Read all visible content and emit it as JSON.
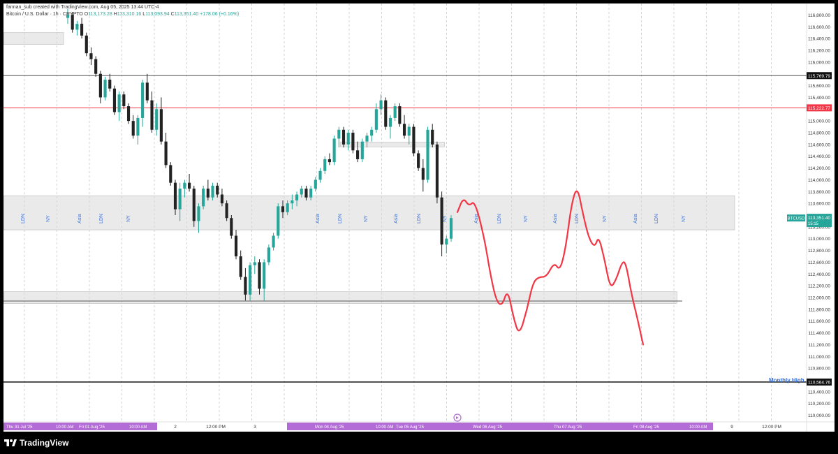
{
  "header": {
    "author_line": "fannan_sub created with TradingView.com, Aug 05, 2025 13:44 UTC-4",
    "symbol_line": "Bitcoin / U.S. Dollar · 1h · CRYPTO",
    "ohlc": {
      "o_label": "O",
      "o": "113,173.28",
      "h_label": "H",
      "h": "113,310.16",
      "l_label": "L",
      "l": "113,093.94",
      "c_label": "C",
      "c": "113,351.40",
      "change": "+178.06 (+0.16%)"
    }
  },
  "colors": {
    "up": "#26a69a",
    "down": "#222222",
    "red": "#f23645",
    "zone": "#d9d9d9",
    "session": "#3a6fd8",
    "purple": "#b36bd6"
  },
  "price_axis": {
    "ticks": [
      "116,800.00",
      "116,600.00",
      "116,400.00",
      "116,200.00",
      "116,000.00",
      "115,800.00",
      "115,600.00",
      "115,400.00",
      "115,200.00",
      "115,000.00",
      "114,800.00",
      "114,600.00",
      "114,400.00",
      "114,200.00",
      "114,000.00",
      "113,800.00",
      "113,600.00",
      "113,400.00",
      "113,200.00",
      "113,000.00",
      "112,800.00",
      "112,600.00",
      "112,400.00",
      "112,200.00",
      "112,000.00",
      "111,800.00",
      "111,600.00",
      "111,400.00",
      "111,200.00",
      "111,000.00",
      "110,800.00",
      "110,600.00",
      "110,400.00",
      "110,200.00",
      "110,000.00"
    ],
    "labels": [
      {
        "text": "115,769.79",
        "kind": "black"
      },
      {
        "text": "115,222.77",
        "kind": "red"
      },
      {
        "text": "113,351.40",
        "kind": "green",
        "ticker": "BTCUSD",
        "sub": "15:15"
      },
      {
        "text": "110,564.76",
        "kind": "black"
      }
    ]
  },
  "annotations": {
    "monthly_high": "Monthly High"
  },
  "sessions": [
    "LDN",
    "NY",
    "Asia",
    "LDN",
    "NY",
    "Asia",
    "LDN",
    "NY",
    "Asia",
    "LDN",
    "NY",
    "Asia",
    "LDN",
    "NY",
    "Asia",
    "LDN",
    "NY",
    "Asia",
    "LDN",
    "NY"
  ],
  "time_axis": {
    "labels": [
      "2",
      "12:00 PM",
      "3",
      "9",
      "12:00 PM"
    ],
    "highlight_text": [
      "Thu 31 Jul '25",
      "10:00 AM",
      "Fri 01 Aug '25",
      "10:00 AM",
      "Mon 04 Aug '25",
      "10:00 AM",
      "Tue 05 Aug '25",
      "Wed 06 Aug '25",
      "Thu 07 Aug '25",
      "Fri 08 Aug '25",
      "10:00 AM"
    ]
  },
  "chart_data": {
    "type": "candlestick",
    "title": "Bitcoin / U.S. Dollar · 1h · CRYPTO",
    "ylim": [
      109900,
      116900
    ],
    "levels": [
      {
        "price": 115769.79,
        "color": "#555555"
      },
      {
        "price": 115222.77,
        "color": "#f23645"
      },
      {
        "price": 110564.76,
        "color": "#000000"
      }
    ],
    "zones": [
      {
        "ymin": 113150,
        "ymax": 113730,
        "xstart": 0,
        "xend": 0.912
      },
      {
        "ymin": 111900,
        "ymax": 112100,
        "xstart": 0,
        "xend": 0.84
      },
      {
        "ymin": 116300,
        "ymax": 116500,
        "xstart": 0,
        "xend": 0.075
      },
      {
        "ymin": 114560,
        "ymax": 114640,
        "xstart": 0.42,
        "xend": 0.55
      }
    ],
    "candles": [
      [
        116750,
        116900,
        116650,
        116800
      ],
      [
        116800,
        116850,
        116500,
        116550
      ],
      [
        116550,
        116700,
        116450,
        116650
      ],
      [
        116650,
        116750,
        116400,
        116450
      ],
      [
        116450,
        116500,
        116100,
        116150
      ],
      [
        116150,
        116250,
        115950,
        116050
      ],
      [
        116050,
        116100,
        115750,
        115800
      ],
      [
        115800,
        115850,
        115300,
        115400
      ],
      [
        115400,
        115750,
        115350,
        115700
      ],
      [
        115700,
        115800,
        115500,
        115550
      ],
      [
        115550,
        115600,
        115100,
        115150
      ],
      [
        115150,
        115500,
        115000,
        115450
      ],
      [
        115450,
        115500,
        115200,
        115250
      ],
      [
        115250,
        115300,
        114950,
        115000
      ],
      [
        115000,
        115100,
        114700,
        114750
      ],
      [
        114750,
        115100,
        114600,
        115050
      ],
      [
        115050,
        115700,
        114900,
        115650
      ],
      [
        115650,
        115800,
        115300,
        115350
      ],
      [
        115350,
        115500,
        114800,
        114850
      ],
      [
        114850,
        115300,
        114750,
        115200
      ],
      [
        115200,
        115400,
        114600,
        114650
      ],
      [
        114650,
        114800,
        114200,
        114250
      ],
      [
        114250,
        114300,
        113900,
        113950
      ],
      [
        113950,
        114000,
        113400,
        113500
      ],
      [
        113500,
        113950,
        113300,
        113850
      ],
      [
        113850,
        114000,
        113700,
        113950
      ],
      [
        113950,
        114100,
        113800,
        113850
      ],
      [
        113850,
        113900,
        113200,
        113300
      ],
      [
        113300,
        113600,
        113100,
        113550
      ],
      [
        113550,
        113900,
        113500,
        113850
      ],
      [
        113850,
        114000,
        113650,
        113700
      ],
      [
        113700,
        113950,
        113650,
        113900
      ],
      [
        113900,
        113950,
        113700,
        113750
      ],
      [
        113750,
        113850,
        113550,
        113600
      ],
      [
        113600,
        113650,
        113300,
        113350
      ],
      [
        113350,
        113400,
        113000,
        113050
      ],
      [
        113050,
        113150,
        112650,
        112700
      ],
      [
        112700,
        112800,
        112300,
        112350
      ],
      [
        112350,
        112500,
        111950,
        112050
      ],
      [
        112050,
        112600,
        111950,
        112550
      ],
      [
        112550,
        112700,
        112400,
        112600
      ],
      [
        112600,
        112650,
        112050,
        112150
      ],
      [
        112150,
        112650,
        111950,
        112600
      ],
      [
        112600,
        112900,
        112550,
        112850
      ],
      [
        112850,
        113100,
        112800,
        113050
      ],
      [
        113050,
        113600,
        113000,
        113550
      ],
      [
        113550,
        113650,
        113350,
        113450
      ],
      [
        113450,
        113650,
        113400,
        113600
      ],
      [
        113600,
        113750,
        113500,
        113650
      ],
      [
        113650,
        113800,
        113550,
        113750
      ],
      [
        113750,
        113900,
        113700,
        113850
      ],
      [
        113850,
        113900,
        113650,
        113700
      ],
      [
        113700,
        113900,
        113650,
        113850
      ],
      [
        113850,
        114050,
        113800,
        114000
      ],
      [
        114000,
        114200,
        113950,
        114150
      ],
      [
        114150,
        114400,
        114100,
        114350
      ],
      [
        114350,
        114450,
        114250,
        114300
      ],
      [
        114300,
        114750,
        114250,
        114700
      ],
      [
        114700,
        114900,
        114550,
        114850
      ],
      [
        114850,
        114900,
        114550,
        114600
      ],
      [
        114600,
        114850,
        114500,
        114800
      ],
      [
        114800,
        114850,
        114450,
        114500
      ],
      [
        114500,
        114650,
        114300,
        114350
      ],
      [
        114350,
        114700,
        114300,
        114650
      ],
      [
        114650,
        114800,
        114550,
        114750
      ],
      [
        114750,
        114900,
        114650,
        114850
      ],
      [
        114850,
        115300,
        114800,
        115200
      ],
      [
        115200,
        115450,
        115100,
        115350
      ],
      [
        115350,
        115400,
        114850,
        114900
      ],
      [
        114900,
        115100,
        114700,
        115050
      ],
      [
        115050,
        115300,
        115000,
        115250
      ],
      [
        115250,
        115300,
        114900,
        114950
      ],
      [
        114950,
        115100,
        114700,
        114750
      ],
      [
        114750,
        114950,
        114600,
        114900
      ],
      [
        114900,
        114950,
        114400,
        114450
      ],
      [
        114450,
        114500,
        114150,
        114200
      ],
      [
        114200,
        114350,
        113800,
        114000
      ],
      [
        114000,
        114900,
        113950,
        114850
      ],
      [
        114850,
        114950,
        114550,
        114600
      ],
      [
        114600,
        114650,
        113600,
        113700
      ],
      [
        113700,
        113800,
        112700,
        112900
      ],
      [
        112900,
        113050,
        112750,
        113000
      ],
      [
        113000,
        113400,
        112950,
        113350
      ]
    ],
    "projection": [
      [
        0,
        113450
      ],
      [
        0.03,
        113700
      ],
      [
        0.06,
        113550
      ],
      [
        0.09,
        113650
      ],
      [
        0.14,
        113000
      ],
      [
        0.17,
        112400
      ],
      [
        0.2,
        111950
      ],
      [
        0.23,
        111850
      ],
      [
        0.26,
        112150
      ],
      [
        0.29,
        111650
      ],
      [
        0.32,
        111350
      ],
      [
        0.36,
        111800
      ],
      [
        0.39,
        112250
      ],
      [
        0.42,
        112350
      ],
      [
        0.46,
        112350
      ],
      [
        0.5,
        112600
      ],
      [
        0.53,
        112450
      ],
      [
        0.56,
        112850
      ],
      [
        0.59,
        113600
      ],
      [
        0.62,
        113900
      ],
      [
        0.65,
        113400
      ],
      [
        0.68,
        113000
      ],
      [
        0.71,
        112850
      ],
      [
        0.73,
        113050
      ],
      [
        0.76,
        112650
      ],
      [
        0.79,
        112150
      ],
      [
        0.82,
        112300
      ],
      [
        0.85,
        112600
      ],
      [
        0.87,
        112600
      ],
      [
        0.9,
        112050
      ],
      [
        0.93,
        111650
      ],
      [
        0.96,
        111200
      ]
    ]
  }
}
